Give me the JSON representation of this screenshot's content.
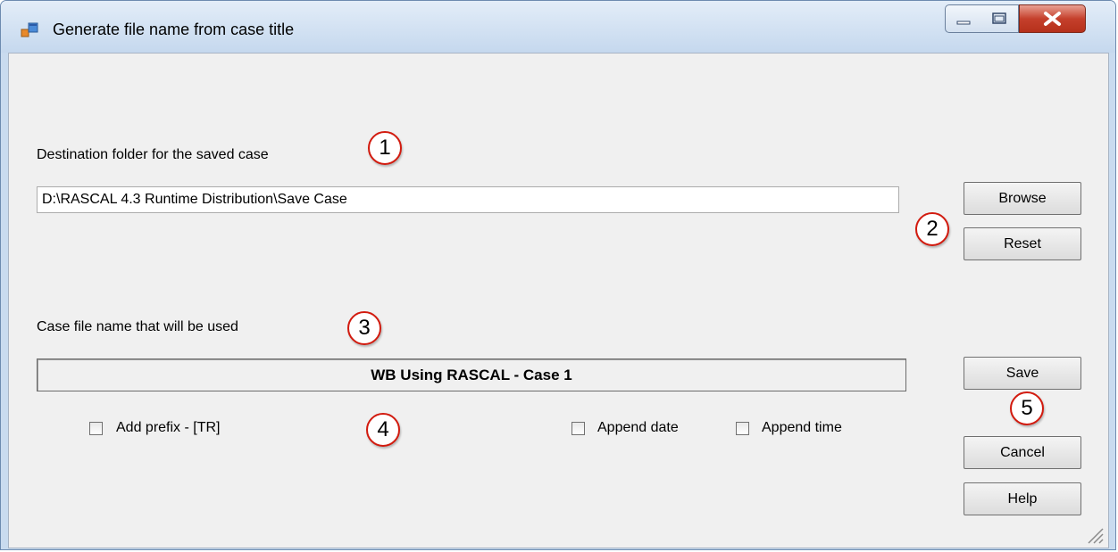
{
  "window": {
    "title": "Generate file name from case title",
    "icon": "app-window-icon",
    "controls": [
      "minimize-icon",
      "maximize-icon",
      "close-icon"
    ]
  },
  "destination": {
    "label": "Destination folder for the saved case",
    "path": "D:\\RASCAL 4.3 Runtime Distribution\\Save Case"
  },
  "buttons": {
    "browse": "Browse",
    "reset": "Reset",
    "save": "Save",
    "cancel": "Cancel",
    "help": "Help"
  },
  "case_file": {
    "label": "Case file name that will be used",
    "name": "WB Using RASCAL - Case 1"
  },
  "options": {
    "add_prefix": {
      "label": "Add prefix - [TR]",
      "checked": false
    },
    "append_date": {
      "label": "Append date",
      "checked": false
    },
    "append_time": {
      "label": "Append time",
      "checked": false
    }
  },
  "callouts": [
    "1",
    "2",
    "3",
    "4",
    "5"
  ],
  "colors": {
    "callout_border": "#d21a0e",
    "close_button": "#c5402c",
    "dialog_background": "#f0f0f0"
  }
}
